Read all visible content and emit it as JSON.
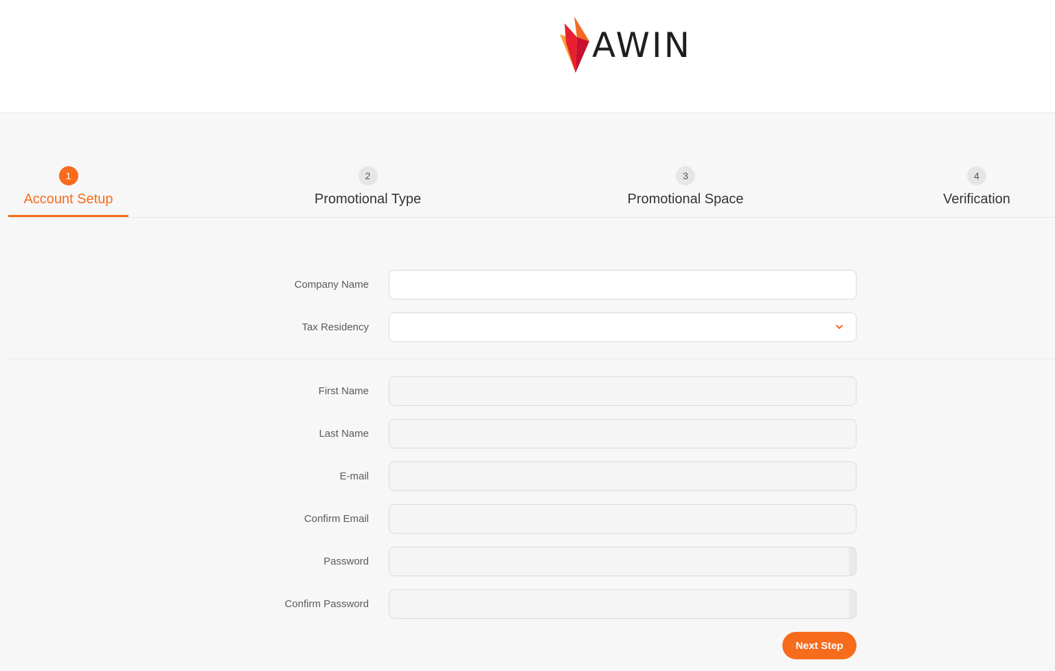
{
  "brand": {
    "logo_text": "AWIN",
    "accent_color": "#f76b1c"
  },
  "steps": [
    {
      "number": "1",
      "label": "Account Setup",
      "active": true
    },
    {
      "number": "2",
      "label": "Promotional Type",
      "active": false
    },
    {
      "number": "3",
      "label": "Promotional Space",
      "active": false
    },
    {
      "number": "4",
      "label": "Verification",
      "active": false
    }
  ],
  "form": {
    "company_name": {
      "label": "Company Name",
      "value": ""
    },
    "tax_residency": {
      "label": "Tax Residency",
      "value": ""
    },
    "first_name": {
      "label": "First Name",
      "value": ""
    },
    "last_name": {
      "label": "Last Name",
      "value": ""
    },
    "email": {
      "label": "E-mail",
      "value": ""
    },
    "confirm_email": {
      "label": "Confirm Email",
      "value": ""
    },
    "password": {
      "label": "Password",
      "value": ""
    },
    "confirm_password": {
      "label": "Confirm Password",
      "value": ""
    },
    "next_label": "Next Step"
  }
}
